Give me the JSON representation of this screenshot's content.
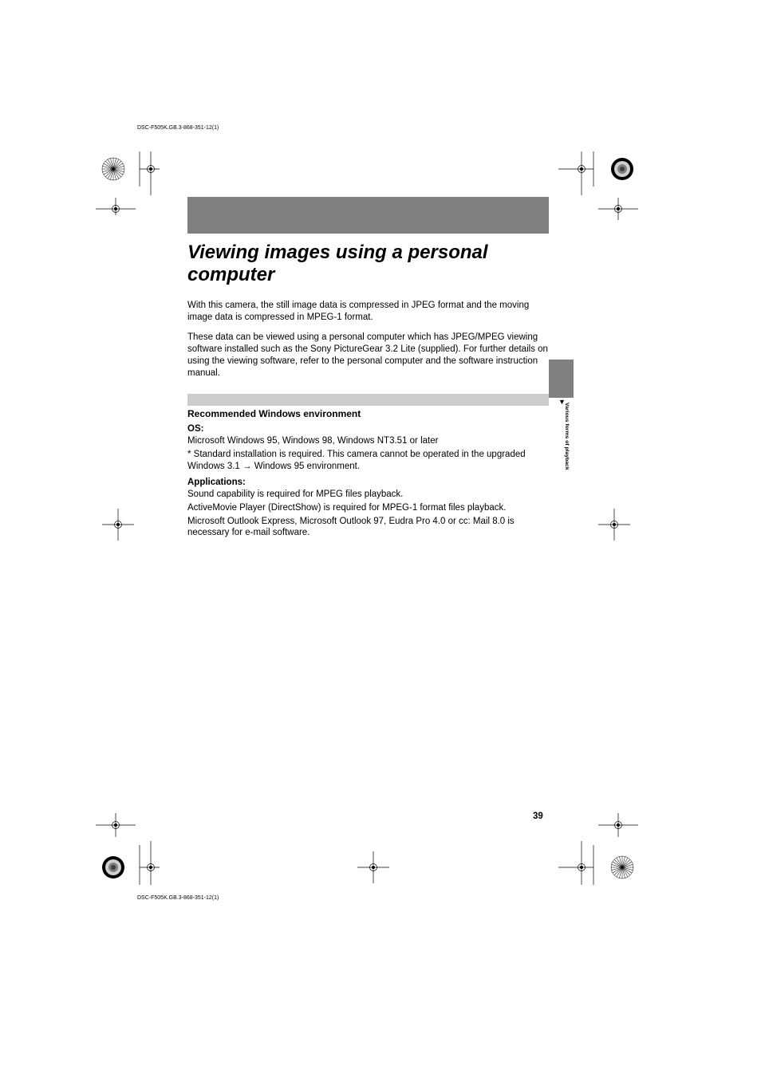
{
  "header_file": "DSC-F505K.GB.3-868-351-12(1)",
  "footer_file": "DSC-F505K.GB.3-868-351-12(1)",
  "title": "Viewing images using a personal computer",
  "paragraphs": {
    "p1": "With this camera, the still image data is compressed in JPEG format and the moving image data is compressed in MPEG-1 format.",
    "p2": "These data can be viewed using a personal computer which has JPEG/MPEG viewing software installed such as the Sony PictureGear 3.2 Lite (supplied). For further details on using the viewing software, refer to the personal computer and the software instruction manual."
  },
  "page_number": "39",
  "side_tab_marker": "▼",
  "side_text": "Various forms of playback",
  "section": {
    "title": "Recommended Windows environment",
    "os": {
      "label": "OS:",
      "body1": "Microsoft Windows 95, Windows 98, Windows NT3.51 or later",
      "body2": "* Standard installation is required. This camera cannot be operated in the upgraded Windows 3.1 → Windows 95 environment."
    },
    "apps": {
      "label": "Applications:",
      "body1": "Sound capability is required for MPEG files playback.",
      "body2": "ActiveMovie Player (DirectShow) is required for MPEG-1 format files playback.",
      "body3": "Microsoft Outlook Express, Microsoft Outlook 97, Eudra Pro 4.0 or cc: Mail 8.0 is necessary for e-mail software."
    }
  }
}
